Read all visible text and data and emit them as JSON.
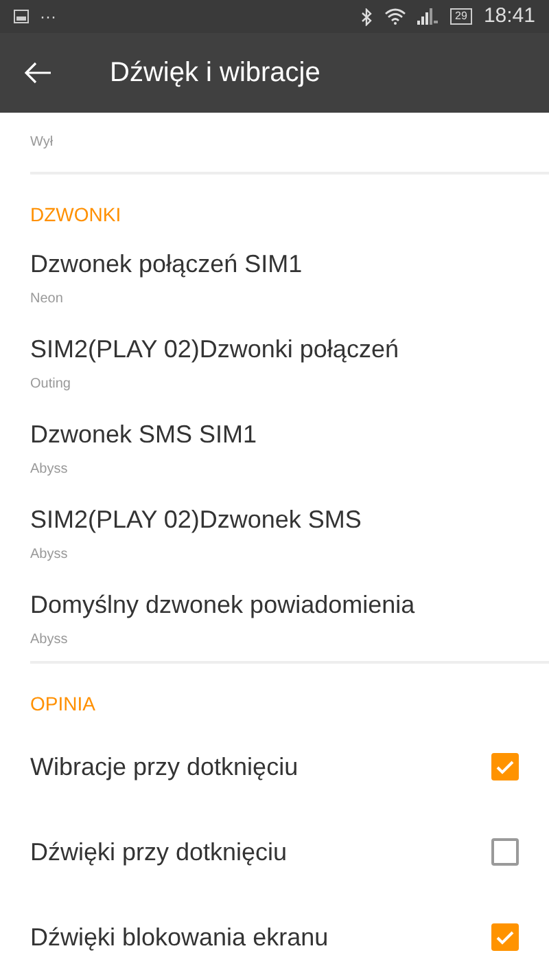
{
  "status_bar": {
    "notification_dots": "···",
    "battery": "29",
    "time": "18:41"
  },
  "app_bar": {
    "title": "Dźwięk i wibracje"
  },
  "sections": [
    {
      "items": [
        {
          "kind": "link",
          "subtitle": "Wył"
        }
      ]
    },
    {
      "header": "DZWONKI",
      "items": [
        {
          "kind": "link",
          "title": "Dzwonek połączeń SIM1",
          "subtitle": "Neon"
        },
        {
          "kind": "link",
          "title": "SIM2(PLAY 02)Dzwonki połączeń",
          "subtitle": "Outing"
        },
        {
          "kind": "link",
          "title": "Dzwonek SMS SIM1",
          "subtitle": "Abyss"
        },
        {
          "kind": "link",
          "title": "SIM2(PLAY 02)Dzwonek SMS",
          "subtitle": "Abyss"
        },
        {
          "kind": "link",
          "title": "Domyślny dzwonek powiadomienia",
          "subtitle": "Abyss"
        }
      ]
    },
    {
      "header": "OPINIA",
      "items": [
        {
          "kind": "checkbox",
          "title": "Wibracje przy dotknięciu",
          "checked": true
        },
        {
          "kind": "checkbox",
          "title": "Dźwięki przy dotknięciu",
          "checked": false
        },
        {
          "kind": "checkbox",
          "title": "Dźwięki blokowania ekranu",
          "checked": true
        }
      ]
    }
  ]
}
